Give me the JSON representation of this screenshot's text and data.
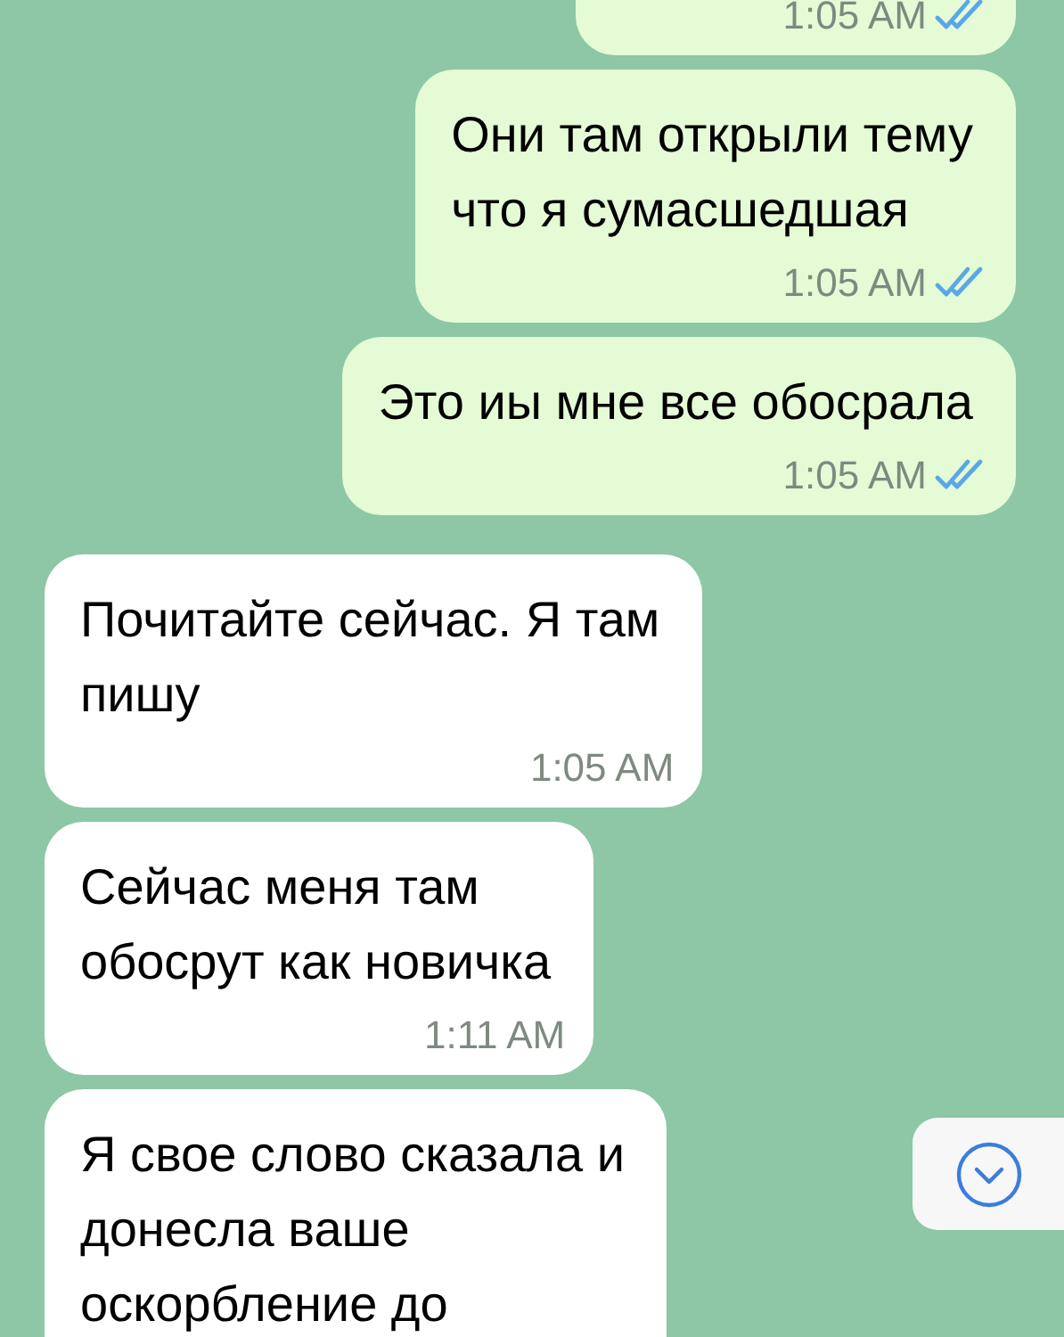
{
  "messages": [
    {
      "outgoing": true,
      "time": "1:05 AM",
      "read": true
    },
    {
      "outgoing": true,
      "text": "Они там открыли тему\nчто я сумасшедшая",
      "time": "1:05 AM",
      "read": true
    },
    {
      "outgoing": true,
      "text": "Это иы мне все обосрала",
      "time": "1:05 AM",
      "read": true
    },
    {
      "outgoing": false,
      "text": "Почитайте сейчас. Я там\nпишу",
      "time": "1:05 AM"
    },
    {
      "outgoing": false,
      "text": "Сейчас меня там\nобосрут как новичка",
      "time": "1:11 AM"
    },
    {
      "outgoing": false,
      "text": "Я свое слово сказала и\nдонесла ваше\nоскорбление до"
    }
  ],
  "scroll_down_button": {
    "visible": true
  }
}
